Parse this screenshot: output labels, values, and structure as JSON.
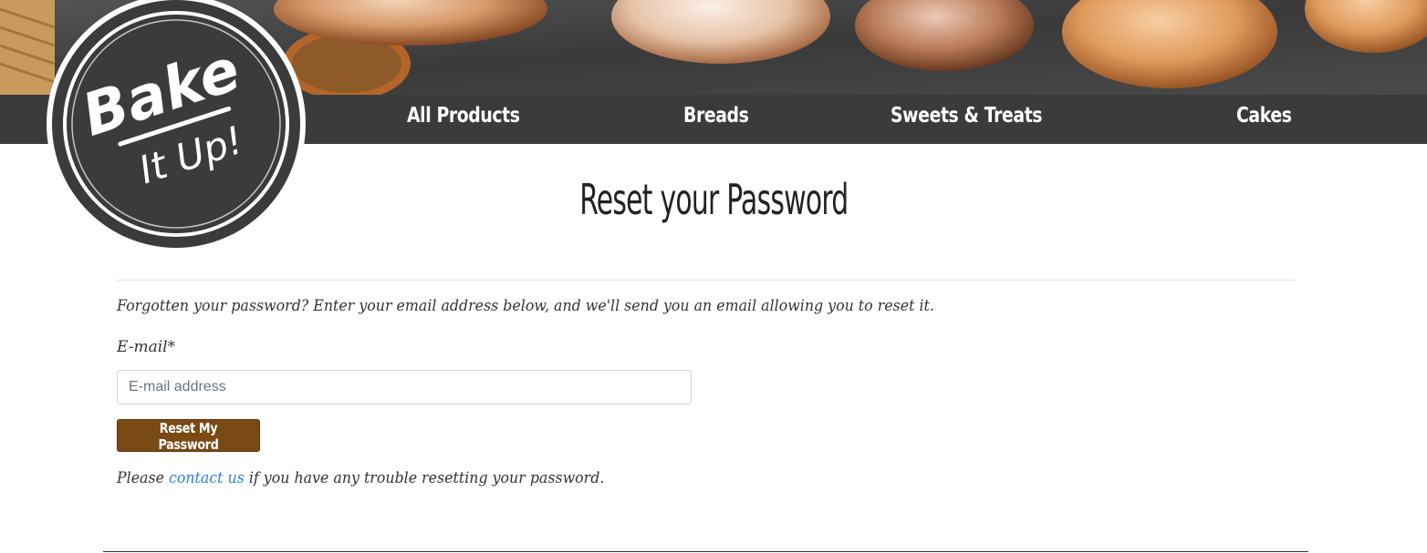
{
  "brand": {
    "logo_line1": "Bake",
    "logo_line2": "It Up!"
  },
  "nav": {
    "items": [
      {
        "label": "All Products"
      },
      {
        "label": "Breads"
      },
      {
        "label": "Sweets & Treats"
      },
      {
        "label": "Cakes"
      }
    ]
  },
  "page": {
    "title": "Reset your Password",
    "intro": "Forgotten your password? Enter your email address below, and we'll send you an email allowing you to reset it.",
    "email_label": "E-mail*",
    "email_placeholder": "E-mail address",
    "email_value": "",
    "submit_label": "Reset My Password",
    "help_prefix": "Please ",
    "help_link": "contact us",
    "help_suffix": " if you have any trouble resetting your password."
  },
  "colors": {
    "nav_bg": "#3b3b3b",
    "button_bg": "#7a4a14",
    "link": "#2a7fd4"
  }
}
